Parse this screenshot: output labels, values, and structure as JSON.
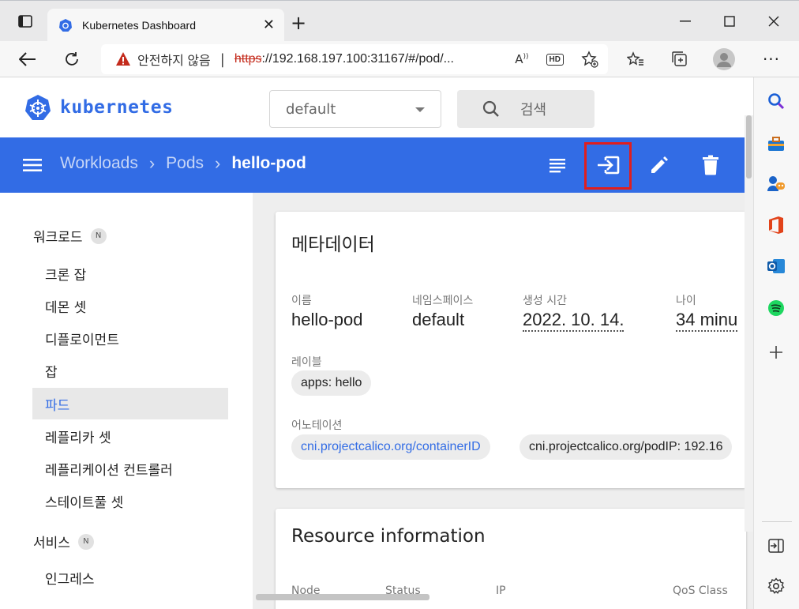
{
  "browser": {
    "tab_title": "Kubernetes Dashboard",
    "address": {
      "security_warning": "안전하지 않음",
      "separator": "|",
      "scheme": "https",
      "url_host": "://192.168.197.100",
      "url_rest": ":31167/#/pod/..."
    },
    "colors": {
      "warning": "#c42b1c"
    }
  },
  "app": {
    "logo_text": "kubernetes",
    "namespace_selector": {
      "value": "default"
    },
    "search": {
      "placeholder": "검색"
    },
    "breadcrumb": {
      "items": [
        "Workloads",
        "Pods"
      ],
      "current": "hello-pod"
    },
    "toolbar_actions": [
      "logs-icon",
      "exec-icon",
      "edit-icon",
      "delete-icon"
    ],
    "colors": {
      "primary": "#326ce5",
      "highlight": "#e01e1e"
    }
  },
  "sidenav": {
    "groups": [
      {
        "label": "워크로드",
        "badge": "N",
        "items": [
          "크론 잡",
          "데몬 셋",
          "디플로이먼트",
          "잡",
          "파드",
          "레플리카 셋",
          "레플리케이션 컨트롤러",
          "스테이트풀 셋"
        ],
        "active": "파드"
      },
      {
        "label": "서비스",
        "badge": "N",
        "items": [
          "인그레스"
        ]
      }
    ]
  },
  "metadata": {
    "title": "메타데이터",
    "name_label": "이름",
    "name_value": "hello-pod",
    "namespace_label": "네임스페이스",
    "namespace_value": "default",
    "created_label": "생성 시간",
    "created_value": "2022. 10. 14.",
    "age_label": "나이",
    "age_value": "34 minu",
    "labels_label": "레이블",
    "labels": [
      "apps: hello"
    ],
    "annotations_label": "어노테이션",
    "annotations": [
      "cni.projectcalico.org/containerID",
      "cni.projectcalico.org/podIP: 192.16"
    ]
  },
  "resource_info": {
    "title": "Resource information",
    "columns": [
      "Node",
      "Status",
      "IP",
      "QoS Class"
    ]
  }
}
